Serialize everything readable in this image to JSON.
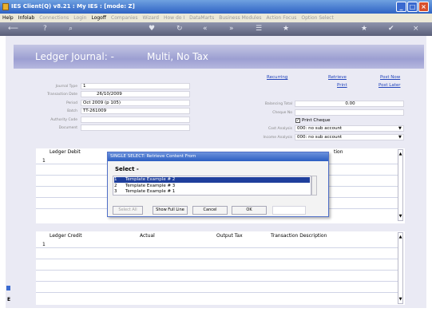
{
  "window": {
    "title": "IES Client(Q) v8.21 : My IES :      [mode: Z]",
    "min": "_",
    "max": "□",
    "close": "×"
  },
  "menu": [
    {
      "label": "Help",
      "dim": false
    },
    {
      "label": "Infolab",
      "dim": false
    },
    {
      "label": "Connections",
      "dim": true
    },
    {
      "label": "Login",
      "dim": true
    },
    {
      "label": "Logoff",
      "dim": false
    },
    {
      "label": "Companies",
      "dim": true
    },
    {
      "label": "Wizard",
      "dim": true
    },
    {
      "label": "How do I",
      "dim": true
    },
    {
      "label": "DataMarts",
      "dim": true
    },
    {
      "label": "Business Modules",
      "dim": true
    },
    {
      "label": "Action Focus",
      "dim": true
    },
    {
      "label": "Option Select",
      "dim": true
    }
  ],
  "toolbar": {
    "back": "⟵",
    "help": "?",
    "search": "⌕",
    "heart": "♥",
    "refresh": "↻",
    "prev": "«",
    "next": "»",
    "list": "☰",
    "fav": "★",
    "ok": "✔",
    "close": "×"
  },
  "header": {
    "title": "Ledger Journal: -",
    "subtitle": "Multi, No Tax"
  },
  "form": {
    "journal_type": {
      "label": "Journal Type",
      "value": "1"
    },
    "transaction_date": {
      "label": "Transaction Date",
      "value": "26/10/2009"
    },
    "period": {
      "label": "Period",
      "value": "Oct 2009 (p 105)"
    },
    "batch": {
      "label": "Batch",
      "value": "TT-261009"
    },
    "authority_code": {
      "label": "Authority Code",
      "value": ""
    },
    "document": {
      "label": "Document",
      "value": ""
    },
    "balancing_total": {
      "label": "Balancing Total",
      "value": "0.00"
    },
    "cheque_no": {
      "label": "Cheque No",
      "value": ""
    },
    "print_cheque": {
      "label": "Print Cheque",
      "checked": true
    },
    "cost_analysis": {
      "label": "Cost Analysis",
      "value": "000: no sub account"
    },
    "income_analysis": {
      "label": "Income Analysis",
      "value": "000: no sub account"
    }
  },
  "links": {
    "recurring": "Recurring",
    "retrieve": "Retrieve",
    "print": "Print",
    "post_now": "Post Now",
    "post_later": "Post Later"
  },
  "debit_grid": {
    "columns": [
      "Ledger Debit",
      "tion"
    ],
    "row_num": "1"
  },
  "credit_grid": {
    "columns": [
      "Ledger Credit",
      "Actual",
      "Output Tax",
      "Transaction Description"
    ],
    "row_num": "1"
  },
  "dialog": {
    "title": "SINGLE SELECT: Retrieve Content From",
    "prompt": "Select -",
    "items": [
      {
        "num": "1",
        "text": "Template Example # 2",
        "selected": true
      },
      {
        "num": "2",
        "text": "Template Example # 3",
        "selected": false
      },
      {
        "num": "3",
        "text": "Template Example # 1",
        "selected": false
      }
    ],
    "buttons": {
      "select_all": "Select All",
      "show_full_line": "Show Full Line",
      "cancel": "Cancel",
      "ok": "OK"
    },
    "search_value": ""
  },
  "side": {
    "mini_label": "E"
  }
}
